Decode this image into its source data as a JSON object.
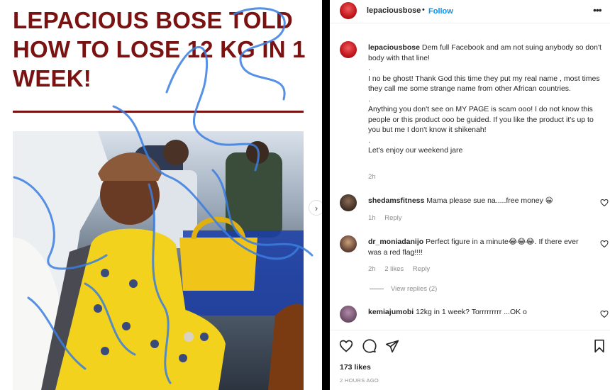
{
  "media": {
    "headline": "LEPACIOUS BOSE TOLD HOW TO LOSE 12 KG IN 1 WEEK!",
    "next_icon": "chevron-right-icon"
  },
  "post": {
    "username": "lepaciousbose",
    "dot": "•",
    "follow_label": "Follow",
    "more_icon": "more-horizontal-icon"
  },
  "caption": {
    "username": "lepaciousbose",
    "lines": [
      "Dem full Facebook and am not suing anybody so don't body with that line!",
      ".",
      "I no be ghost! Thank God this time they put my real name , most times they call me some strange name from other African countries.",
      ".",
      "Anything you don't see on MY PAGE is scam ooo! I do not know this people or this product ooo be guided. If you like the product it's up to you but me I don't know it shikenah!",
      ".",
      "Let's enjoy our weekend jare"
    ],
    "time": "2h"
  },
  "comments": [
    {
      "username": "shedamsfitness",
      "text": "Mama please sue na.....free money 😀",
      "time": "1h",
      "likes": "",
      "reply": "Reply",
      "avatar_color": "#3a2b22"
    },
    {
      "username": "dr_moniadanijo",
      "text": "Perfect figure in a minute😂😂😂. If there ever was a red flag!!!!",
      "time": "2h",
      "likes": "2 likes",
      "reply": "Reply",
      "avatar_color": "#5a3b2e"
    },
    {
      "username": "kemiajumobi",
      "text": "12kg in 1 week? Torrrrrrrrr ...OK o",
      "time": "",
      "likes": "",
      "reply": "",
      "avatar_color": "#6a4a63"
    }
  ],
  "view_replies": "View replies (2)",
  "actions": {
    "like_icon": "heart-icon",
    "comment_icon": "comment-icon",
    "share_icon": "send-icon",
    "save_icon": "bookmark-icon",
    "likes": "173 likes",
    "posted": "2 HOURS AGO"
  },
  "colors": {
    "headline": "#7a1212",
    "follow": "#0095f6",
    "scribble": "#3a7ee0"
  }
}
